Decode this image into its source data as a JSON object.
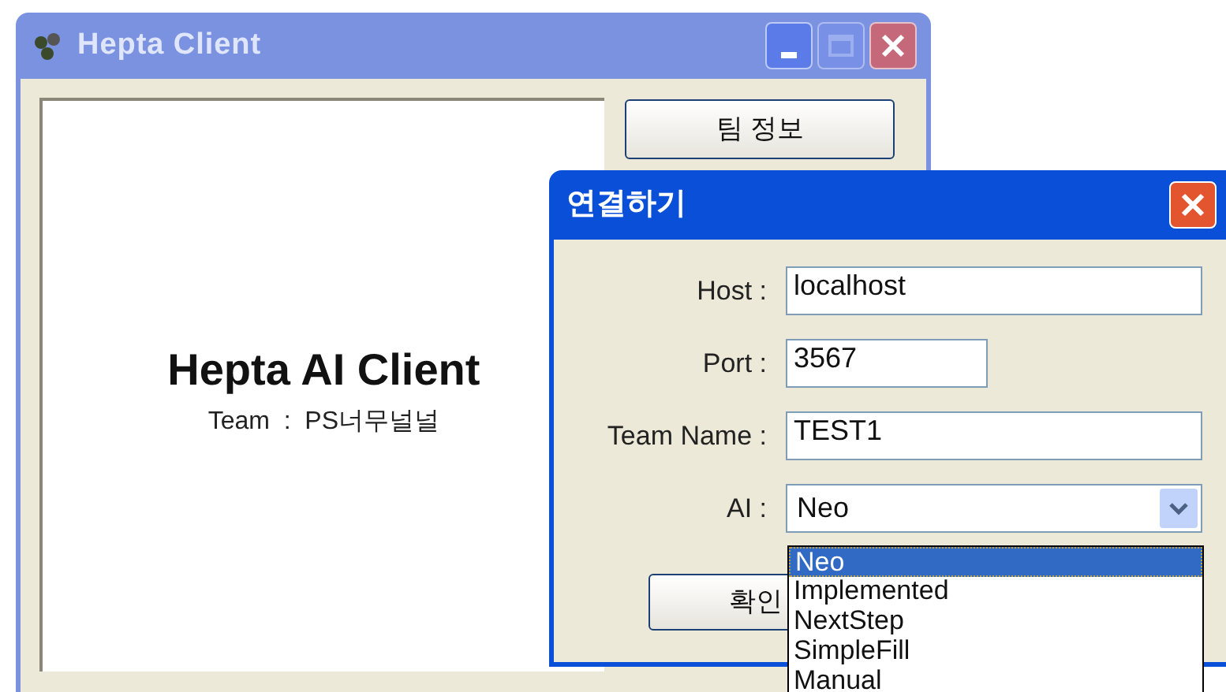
{
  "main_window": {
    "title": "Hepta Client",
    "display": {
      "title": "Hepta AI Client",
      "subtitle": "Team  :  PS너무널널"
    },
    "team_info_button": "팀 정보"
  },
  "dialog": {
    "title": "연결하기",
    "fields": [
      {
        "kind": "text",
        "label": "Host :",
        "value": "localhost"
      },
      {
        "kind": "short",
        "label": "Port :",
        "value": "3567"
      },
      {
        "kind": "text",
        "label": "Team Name :",
        "value": "TEST1"
      },
      {
        "kind": "combo",
        "label": "AI :",
        "value": "Neo"
      }
    ],
    "confirm_button": "확인",
    "dropdown_options": [
      {
        "label": "Neo",
        "selected": true
      },
      {
        "label": "Implemented",
        "selected": false
      },
      {
        "label": "NextStep",
        "selected": false
      },
      {
        "label": "SimpleFill",
        "selected": false
      },
      {
        "label": "Manual",
        "selected": false
      }
    ]
  }
}
